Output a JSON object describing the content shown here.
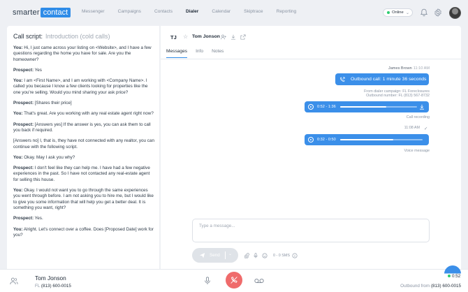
{
  "app": {
    "logo_word1": "smarter",
    "logo_word2": "contact"
  },
  "nav": {
    "items": [
      "Messenger",
      "Campaigns",
      "Contacts",
      "Dialer",
      "Calendar",
      "Skiptrace",
      "Reporting"
    ],
    "active": "Dialer"
  },
  "status": {
    "label": "Online"
  },
  "script": {
    "title": "Call script:",
    "subtitle": "Introduction (cold calls)",
    "lines": [
      {
        "speaker": "You:",
        "text": " Hi, I just came across your listing on <Website>, and I have a few questions regarding the home you have for sale. Are you the homeowner?"
      },
      {
        "speaker": "Prospect:",
        "text": " Yes"
      },
      {
        "speaker": "You:",
        "text": " I am <First Name>, and I am working with <Company Name>. I called you because I know a few clients looking for properties like the one you're selling. Would you mind sharing your ask price?"
      },
      {
        "speaker": "Prospect:",
        "text": " [Shares their price]"
      },
      {
        "speaker": "You:",
        "text": " That's great. Are you working with any real estate agent right now?"
      },
      {
        "speaker": "Prospect:",
        "text": " [Answers yes] If the answer is yes, you can ask them to call you back if required."
      },
      {
        "speaker": "",
        "text": "[Answers no] I, that is, they have not connected with any realtor, you can continue with the following script."
      },
      {
        "speaker": "You:",
        "text": " Okay. May I ask you why?"
      },
      {
        "speaker": "Prospect:",
        "text": " I don't feel like they can help me. I have had a few negative experiences in the past. So I have not contacted any real-estate agent for selling this house."
      },
      {
        "speaker": "You:",
        "text": " Okay. I would not want you to go through the same experiences you went through before. I am not asking you to hire me, but I would like to give you some information that will help you get a better deal. It is something you want, right?"
      },
      {
        "speaker": "Prospect:",
        "text": " Yes."
      },
      {
        "speaker": "You:",
        "text": " Alright. Let's connect over a coffee. Does [Proposed Date] work for you?"
      }
    ]
  },
  "contact": {
    "initials": "TJ",
    "name": "Tom Jonson"
  },
  "tabs": [
    "Messages",
    "Info",
    "Notes"
  ],
  "active_tab": "Messages",
  "conversation": {
    "sender": "James Brown",
    "sender_time": "11:10 AM",
    "call_bubble": "Outbound call:  1 minute 36 seconds",
    "campaign_line": "From dialer campaign: FL Foreclosures",
    "outbound_line": "Outbound number: FL (813) 567-8732",
    "recording": {
      "time": "0:52 - 1:36",
      "progress": 0.6
    },
    "recording_label": "Call recording",
    "voice_time": "11:08 AM",
    "voicemail": {
      "time": "0:32 - 0:50",
      "progress": 0.64
    },
    "voicemail_label": "Voice message"
  },
  "composer": {
    "placeholder": "Type a message...",
    "send_label": "Send",
    "sms_count": "0 - 0 SMS"
  },
  "bottom": {
    "name": "Tom Jonson",
    "state": "FL",
    "phone": " (813) 600-0015",
    "timer": "0:52",
    "outbound_prefix": "Outbound from ",
    "outbound_number": "(813) 600-0015"
  },
  "colors": {
    "accent": "#3b8fe9",
    "hangup": "#ef6b6b",
    "online": "#2ecc71"
  }
}
